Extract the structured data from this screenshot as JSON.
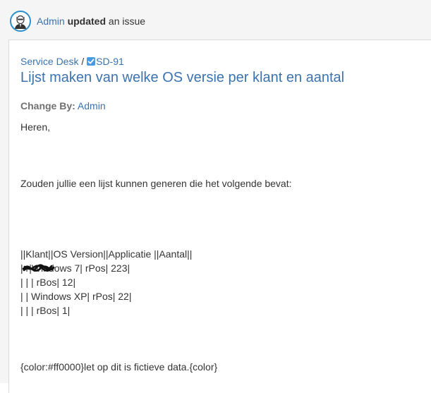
{
  "activity": {
    "actor": "Admin",
    "verb": "updated",
    "object": "an issue",
    "avatar_icon": "admin-avatar-icon"
  },
  "issue": {
    "project": "Service Desk",
    "separator": "/",
    "key": "SD-91",
    "type_icon": "task-checkbox-icon",
    "summary": "Lijst maken van welke OS versie per klant en aantal"
  },
  "change": {
    "label": "Change By:",
    "user": "Admin"
  },
  "description": {
    "greeting": "Heren,",
    "request": "Zouden jullie een lijst kunnen generen die het volgende bevat:",
    "table_lines": [
      "||Klant||OS Version||Applicatie ||Aantal||",
      "| r|Windows 7| rPos| 223|",
      "| | | rBos| 12|",
      "| | Windows XP| rPos| 22|",
      "| | | rBos| 1|"
    ],
    "note": "{color:#ff0000}let op dit is fictieve data.{color}"
  },
  "colors": {
    "link": "#3b73af",
    "text": "#333333",
    "label": "#707070",
    "background": "#f5f5f5",
    "card": "#ffffff",
    "checkbox": "#4a9ae1"
  }
}
